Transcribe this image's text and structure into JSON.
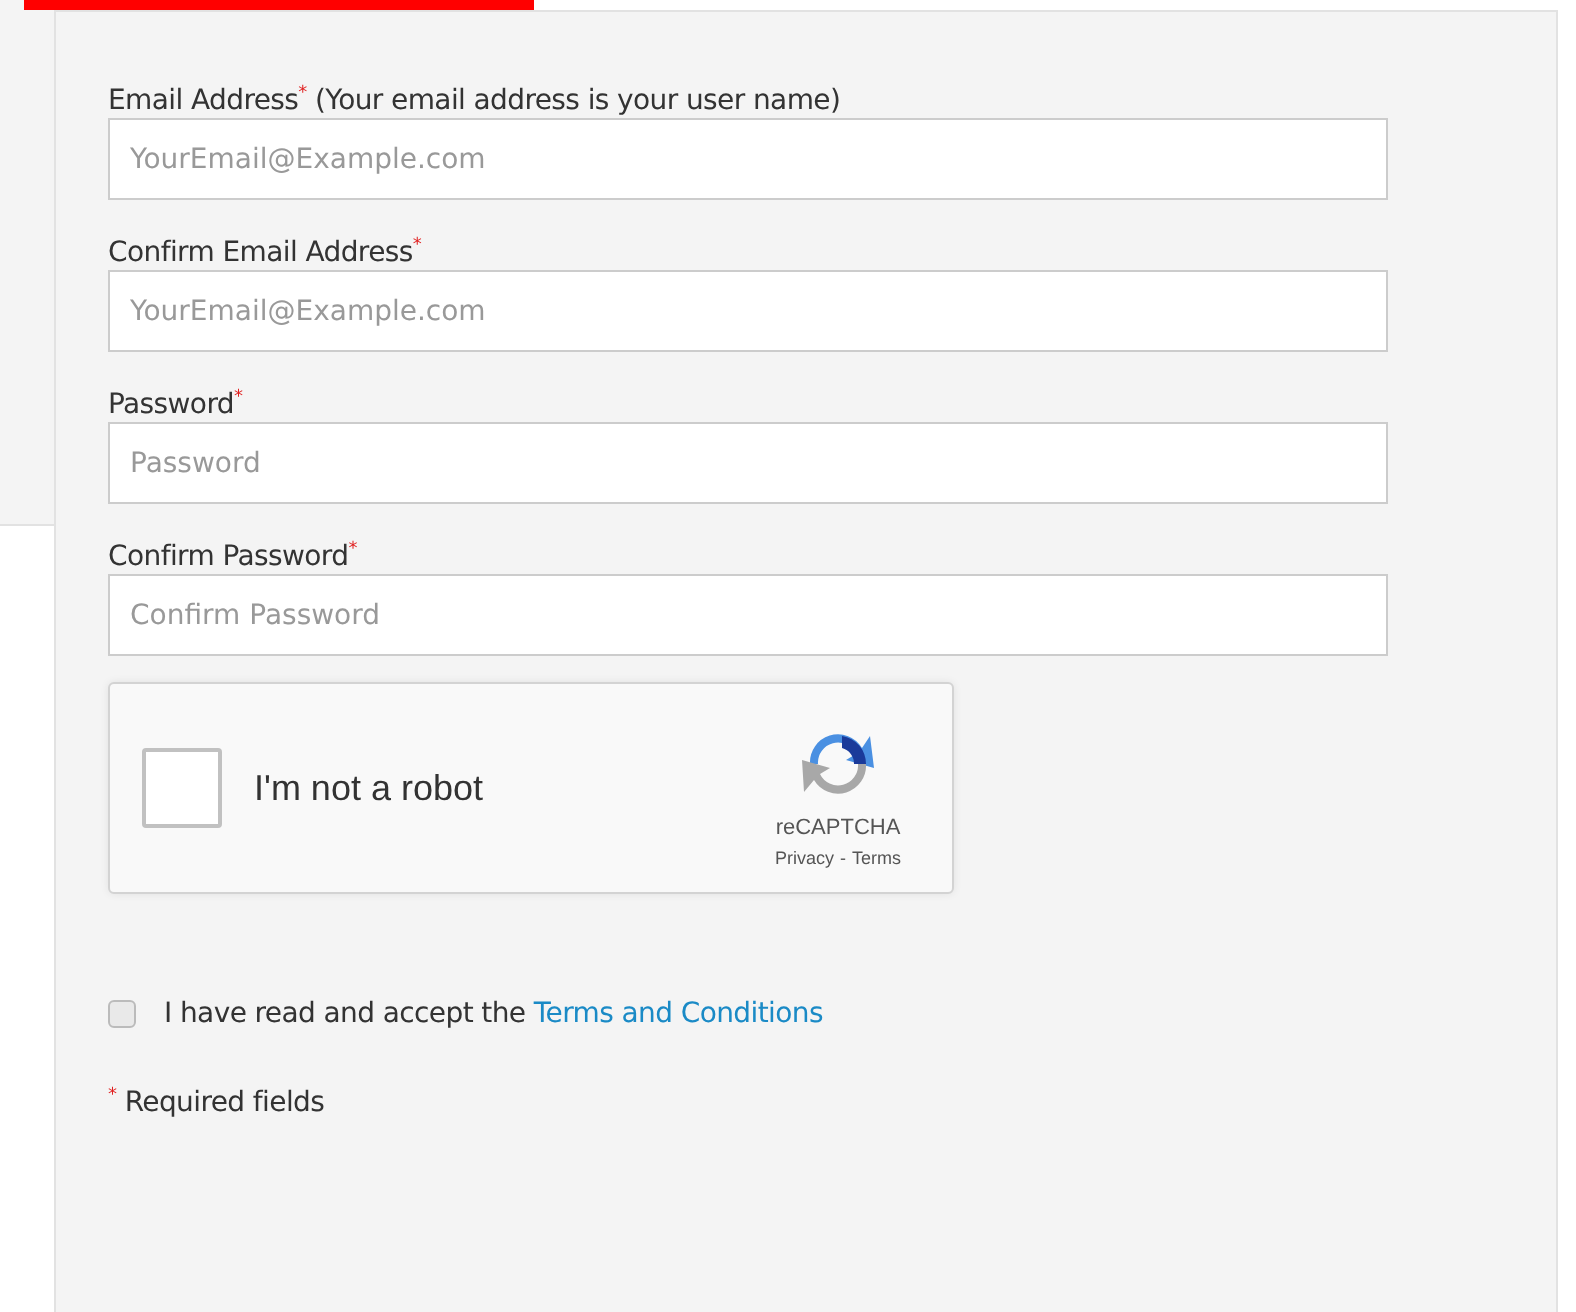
{
  "fields": [
    {
      "label": "Email Address$^{*}$ (Your email address is your user name)",
      "placeholder": "YourEmail@Example.com"
    },
    {
      "label": "Confirm Email Address$^{*}$",
      "placeholder": "YourEmail@Example.com"
    },
    {
      "label": "Password$^{*}$",
      "placeholder": "Password"
    },
    {
      "label": "Confirm Password$^{*}$",
      "placeholder": "Confirm Password"
    }
  ],
  "captcha": {
    "label": "I'm not a robot",
    "checked": false,
    "brand": "reCAPTCHA",
    "privacy": "Privacy",
    "separator": "-",
    "terms": "Terms"
  },
  "terms": {
    "text": "I have read and accept the",
    "link": "Terms and Conditions",
    "checked": false
  },
  "footnote": "$^{*}$ Required fields"
}
